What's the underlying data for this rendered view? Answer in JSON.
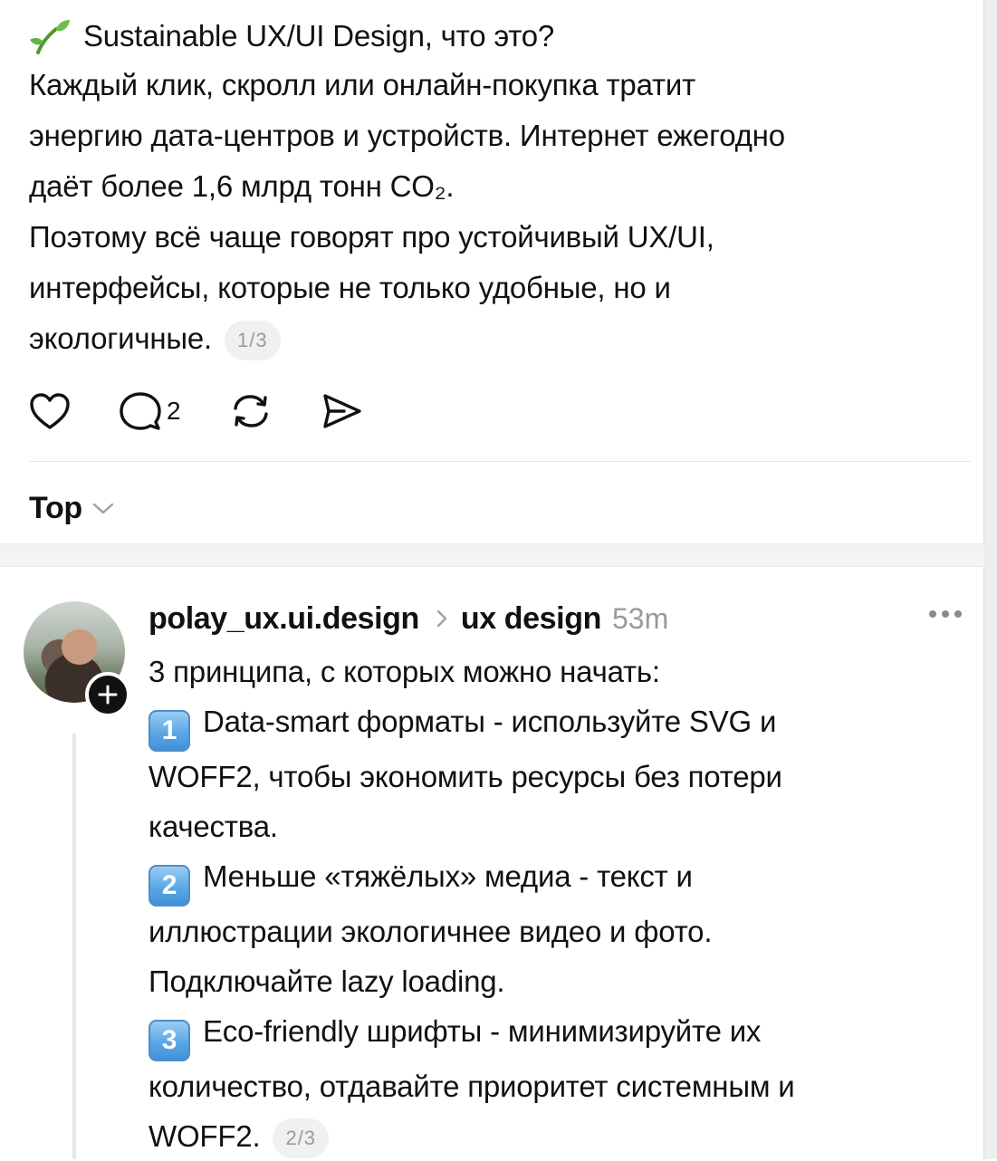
{
  "post": {
    "title": "Sustainable UX/UI Design, что это?",
    "para1": [
      "Каждый клик, скролл или онлайн-покупка тратит",
      "энергию дата-центров и устройств. Интернет ежегодно",
      "даёт более 1,6 млрд тонн CO₂."
    ],
    "para2": [
      "Поэтому всё чаще говорят про устойчивый UX/UI,",
      "интерфейсы, которые не только удобные, но и",
      "экологичные."
    ],
    "page_badge": "1/3"
  },
  "actions": {
    "like_icon": "heart-icon",
    "comment_icon": "comment-icon",
    "comment_count": "2",
    "repost_icon": "repost-icon",
    "share_icon": "send-icon"
  },
  "sort": {
    "label": "Top"
  },
  "reply": {
    "username": "polay_ux.ui.design",
    "topic": "ux design",
    "time": "53m",
    "intro": "3 принципа, с которых можно начать:",
    "points": [
      {
        "num": "1",
        "lines": [
          "Data-smart форматы - используйте SVG и",
          "WOFF2, чтобы экономить ресурсы без потери",
          "качества."
        ]
      },
      {
        "num": "2",
        "lines": [
          "Меньше «тяжёлых» медиа - текст и",
          "иллюстрации экологичнее видео и фото.",
          "Подключайте lazy loading."
        ]
      },
      {
        "num": "3",
        "lines": [
          "Eco-friendly шрифты - минимизируйте их",
          "количество, отдавайте приоритет системным и",
          "WOFF2."
        ]
      }
    ],
    "page_badge": "2/3"
  },
  "colors": {
    "accent_text": "#111111",
    "muted": "#9a9a9a",
    "keycap": "#5aa7e6"
  }
}
